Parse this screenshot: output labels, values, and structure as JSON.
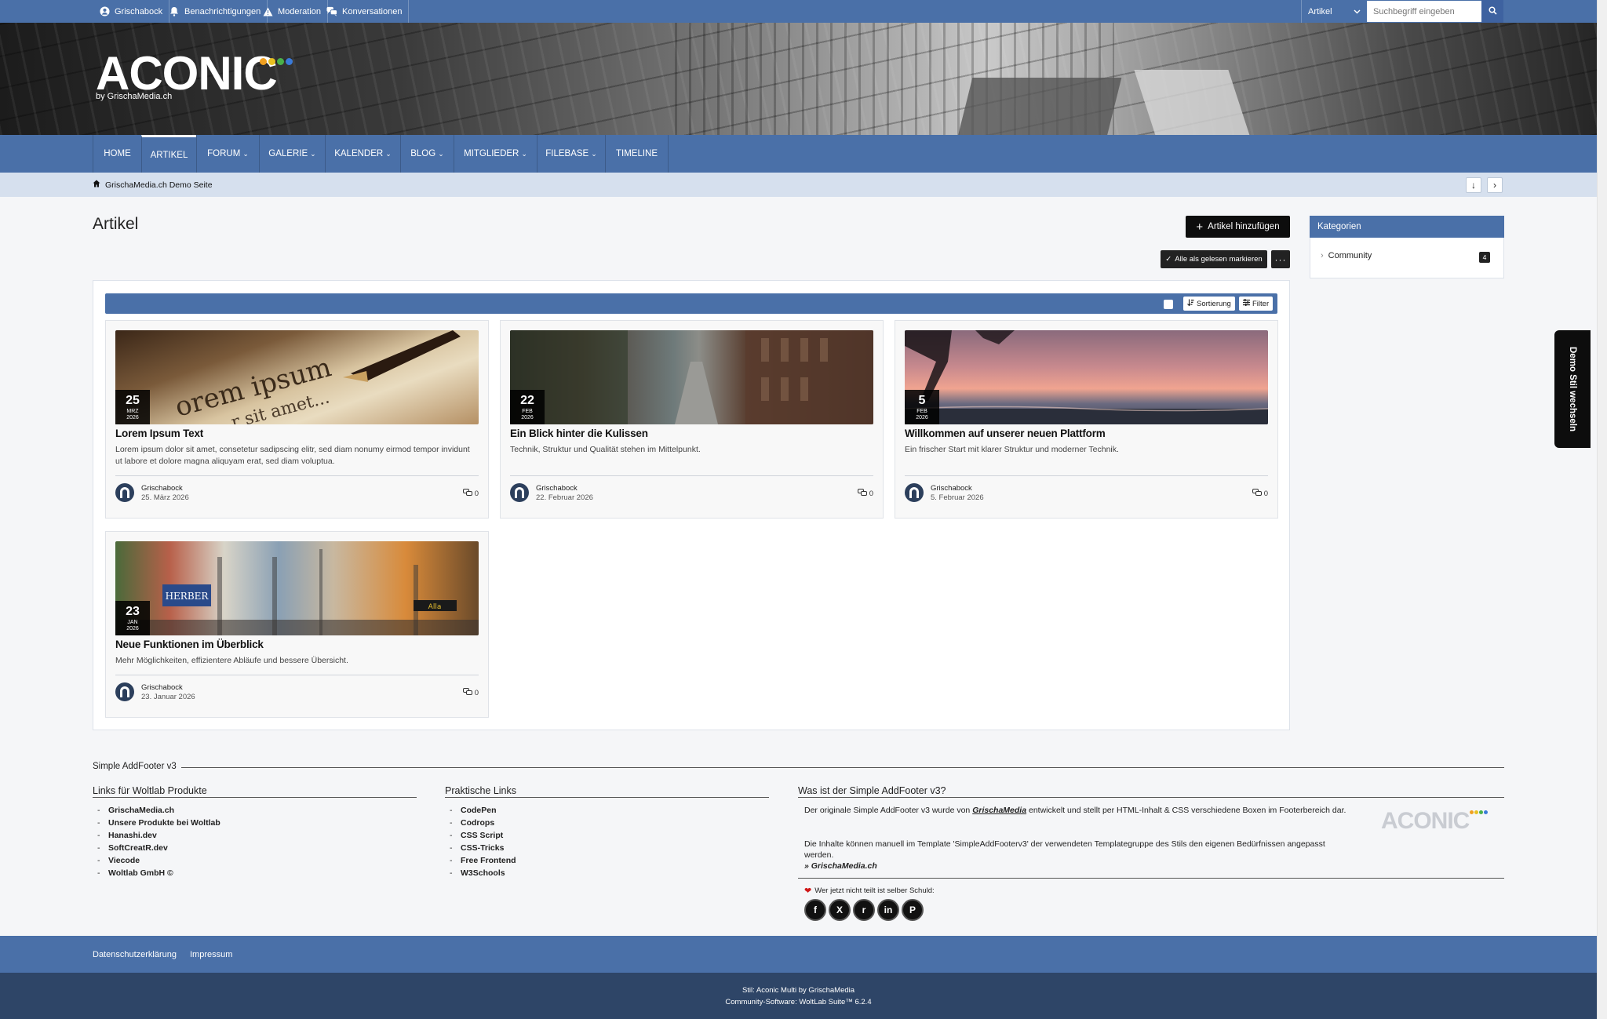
{
  "userbar": {
    "items": [
      {
        "label": "Grischabock",
        "icon": "user-icon"
      },
      {
        "label": "Benachrichtigungen",
        "icon": "bell-icon"
      },
      {
        "label": "Moderation",
        "icon": "warning-icon"
      },
      {
        "label": "Konversationen",
        "icon": "conversations-icon"
      }
    ],
    "search_scope": "Artikel",
    "search_placeholder": "Suchbegriff eingeben"
  },
  "header": {
    "logo_text": "ACONIC",
    "logo_sub": "by GrischaMedia.ch",
    "logo_dot_colors": [
      "#f0a020",
      "#e8c020",
      "#4ab04a",
      "#3a7ad8"
    ]
  },
  "nav": {
    "items": [
      {
        "label": "Home",
        "caret": false
      },
      {
        "label": "Artikel",
        "caret": false,
        "active": true
      },
      {
        "label": "Forum",
        "caret": true
      },
      {
        "label": "Galerie",
        "caret": true
      },
      {
        "label": "Kalender",
        "caret": true
      },
      {
        "label": "Blog",
        "caret": true
      },
      {
        "label": "Mitglieder",
        "caret": true
      },
      {
        "label": "Filebase",
        "caret": true
      },
      {
        "label": "Timeline",
        "caret": false
      }
    ]
  },
  "breadcrumb": {
    "label": "GrischaMedia.ch Demo Seite"
  },
  "main": {
    "title": "Artikel",
    "add_button": "Artikel hinzufügen",
    "mark_read_button": "Alle als gelesen markieren",
    "more_button": "···",
    "sort_label": "Sortierung",
    "filter_label": "Filter"
  },
  "articles": [
    {
      "day": "25",
      "month": "MRZ",
      "year": "2026",
      "title": "Lorem Ipsum Text",
      "teaser": "Lorem ipsum dolor sit amet, consetetur sadipscing elitr, sed diam nonumy eirmod tempor invidunt ut labore et dolore magna aliquyam erat, sed diam voluptua.",
      "author": "Grischabock",
      "date": "25. März 2026",
      "comments": "0"
    },
    {
      "day": "22",
      "month": "FEB",
      "year": "2026",
      "title": "Ein Blick hinter die Kulissen",
      "teaser": "Technik, Struktur und Qualität stehen im Mittelpunkt.",
      "author": "Grischabock",
      "date": "22. Februar 2026",
      "comments": "0"
    },
    {
      "day": "5",
      "month": "FEB",
      "year": "2026",
      "title": "Willkommen auf unserer neuen Plattform",
      "teaser": "Ein frischer Start mit klarer Struktur und moderner Technik.",
      "author": "Grischabock",
      "date": "5. Februar 2026",
      "comments": "0"
    },
    {
      "day": "23",
      "month": "JAN",
      "year": "2026",
      "title": "Neue Funktionen im Überblick",
      "teaser": "Mehr Möglichkeiten, effizientere Abläufe und bessere Übersicht.",
      "author": "Grischabock",
      "date": "23. Januar 2026",
      "comments": "0"
    }
  ],
  "sidebar": {
    "title": "Kategorien",
    "categories": [
      {
        "label": "Community",
        "count": "4"
      }
    ]
  },
  "style_switch": "Demo Stil wechseln",
  "addfooter": {
    "title": "Simple AddFooter v3",
    "col1_title": "Links für Woltlab Produkte",
    "col1_links": [
      "GrischaMedia.ch",
      "Unsere Produkte bei Woltlab",
      "Hanashi.dev",
      "SoftCreatR.dev",
      "Viecode",
      "Woltlab GmbH ©"
    ],
    "col2_title": "Praktische Links",
    "col2_links": [
      "CodePen",
      "Codrops",
      "CSS Script",
      "CSS-Tricks",
      "Free Frontend",
      "W3Schools"
    ],
    "col3_title": "Was ist der Simple AddFooter v3?",
    "col3_p1_a": "Der originale Simple AddFooter v3 wurde von ",
    "col3_p1_b": "GrischaMedia",
    "col3_p1_c": " entwickelt und stellt per HTML-Inhalt & CSS verschiedene Boxen im Footerbereich dar.",
    "col3_p2": "Die Inhalte können manuell im Template 'SimpleAddFooterv3' der verwendeten Templategruppe des Stils den eigenen Bedürfnissen angepasst werden.",
    "col3_link": "» GrischaMedia.ch",
    "share_label": "Wer jetzt nicht teilt ist selber Schuld:",
    "share_buttons": [
      {
        "icon": "facebook-icon",
        "glyph": "f"
      },
      {
        "icon": "x-icon",
        "glyph": "X"
      },
      {
        "icon": "reddit-icon",
        "glyph": "r"
      },
      {
        "icon": "linkedin-icon",
        "glyph": "in"
      },
      {
        "icon": "pinterest-icon",
        "glyph": "P"
      }
    ]
  },
  "footer": {
    "links": [
      "Datenschutzerklärung",
      "Impressum"
    ],
    "style_credit": "Stil: Aconic Multi by GrischaMedia",
    "software_credit": "Community-Software: WoltLab Suite™ 6.2.4"
  }
}
